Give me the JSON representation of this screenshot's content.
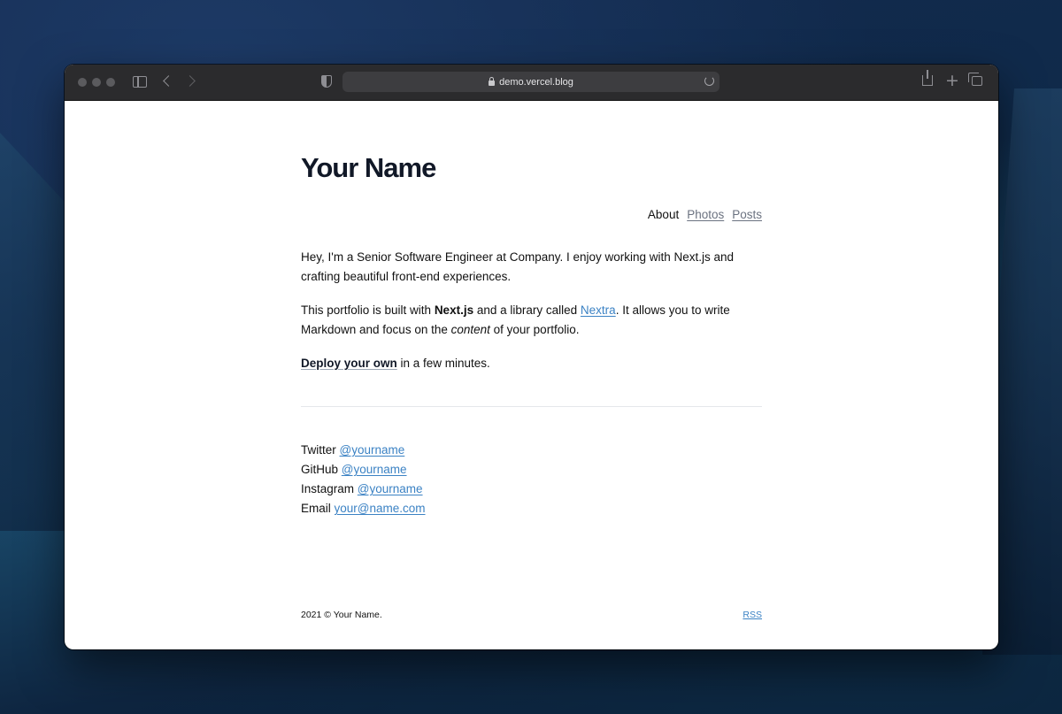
{
  "browser": {
    "url": "demo.vercel.blog"
  },
  "site": {
    "title": "Your Name",
    "nav": [
      {
        "label": "About"
      },
      {
        "label": "Photos"
      },
      {
        "label": "Posts"
      }
    ],
    "intro": {
      "text": "Hey, I'm a Senior Software Engineer at Company. I enjoy working with Next.js and crafting beautiful front-end experiences."
    },
    "portfolio": {
      "prefix": "This portfolio is built with ",
      "bold": "Next.js",
      "middle": " and a library called ",
      "link": "Nextra",
      "suffix_1": ". It allows you to write Markdown and focus on the ",
      "italic": "content",
      "suffix_2": " of your portfolio."
    },
    "deploy": {
      "link": "Deploy your own",
      "suffix": " in a few minutes."
    },
    "contacts": [
      {
        "label": "Twitter",
        "handle": "@yourname"
      },
      {
        "label": "GitHub",
        "handle": "@yourname"
      },
      {
        "label": "Instagram",
        "handle": "@yourname"
      },
      {
        "label": "Email",
        "handle": "your@name.com"
      }
    ],
    "footer": {
      "copyright": "2021 © Your Name.",
      "rss": "RSS"
    }
  },
  "colors": {
    "link": "#3b82c4",
    "text": "#111111",
    "muted_link": "#6b7280"
  }
}
